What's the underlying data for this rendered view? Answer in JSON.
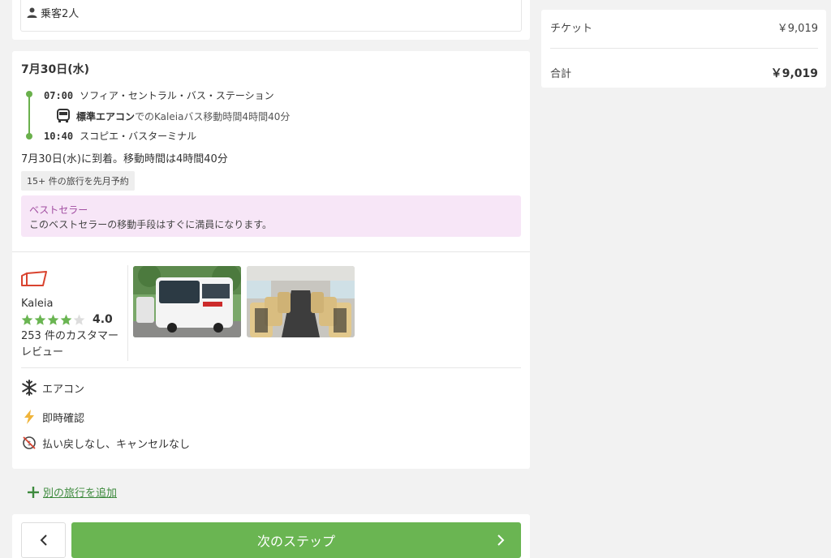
{
  "passenger": {
    "label": "乗客2人"
  },
  "trip": {
    "date": "7月30日(水)",
    "departure_time": "07:00",
    "departure_station": "ソフィア・セントラル・バス・ステーション",
    "bus_class": "標準エアコン",
    "bus_info_rest": "でのKaleiaバス移動時間4時間40分",
    "arrival_time": "10:40",
    "arrival_station": "スコピエ・バスターミナル",
    "arrival_summary": "7月30日(水)に到着。移動時間は4時間40分",
    "booked_badge": "15+ 件の旅行を先月予約",
    "bestseller_title": "ベストセラー",
    "bestseller_desc": "このベストセラーの移動手段はすぐに満員になります。"
  },
  "operator": {
    "name": "Kaleia",
    "rating": "4.0",
    "rating_stars": 4,
    "reviews": "253 件のカスタマーレビュー"
  },
  "features": [
    {
      "icon": "snowflake-icon",
      "label": "エアコン"
    },
    {
      "icon": "lightning-icon",
      "label": "即時確認"
    },
    {
      "icon": "no-refund-icon",
      "label": "払い戻しなし、キャンセルなし"
    }
  ],
  "add_trip": {
    "label": "別の旅行を追加"
  },
  "nav": {
    "next_label": "次のステップ"
  },
  "summary": {
    "ticket_label": "チケット",
    "ticket_value": "￥9,019",
    "total_label": "合計",
    "total_value": "￥9,019"
  },
  "colors": {
    "accent_green": "#6ab552",
    "bestseller_bg": "#f7e6f7",
    "logo_red": "#d9432f"
  }
}
